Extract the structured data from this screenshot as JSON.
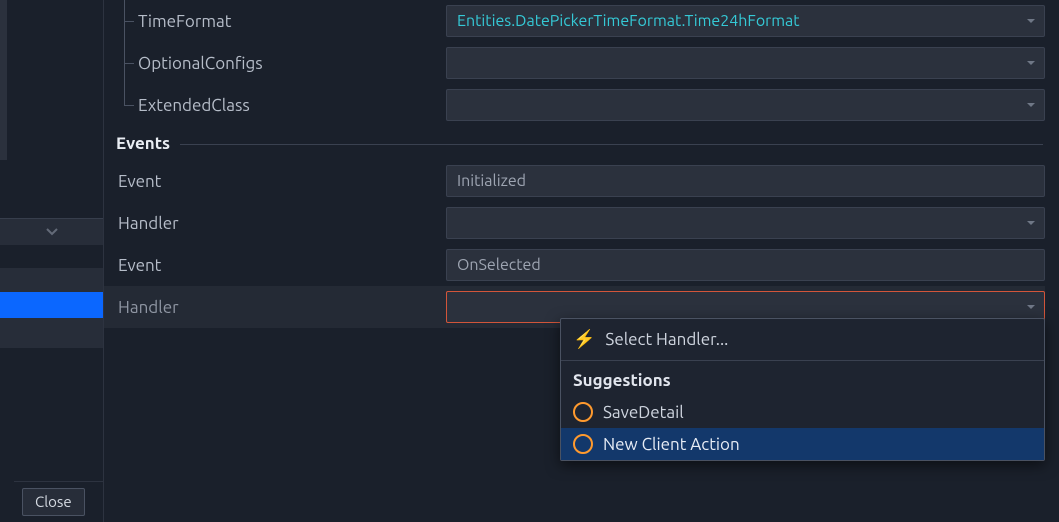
{
  "leftPanel": {
    "close_label": "Close"
  },
  "props": {
    "timeFormat": {
      "label": "TimeFormat",
      "value": "Entities.DatePickerTimeFormat.Time24hFormat"
    },
    "optionalConfigs": {
      "label": "OptionalConfigs",
      "value": ""
    },
    "extendedClass": {
      "label": "ExtendedClass",
      "value": ""
    }
  },
  "sections": {
    "events": "Events"
  },
  "events": {
    "event1": {
      "label": "Event",
      "value": "Initialized"
    },
    "handler1": {
      "label": "Handler",
      "value": ""
    },
    "event2": {
      "label": "Event",
      "value": "OnSelected"
    },
    "handler2": {
      "label": "Handler",
      "value": ""
    }
  },
  "dropdown": {
    "header": "Select Handler...",
    "suggestions_label": "Suggestions",
    "items": {
      "saveDetail": "SaveDetail",
      "newClientAction": "New Client Action"
    }
  }
}
